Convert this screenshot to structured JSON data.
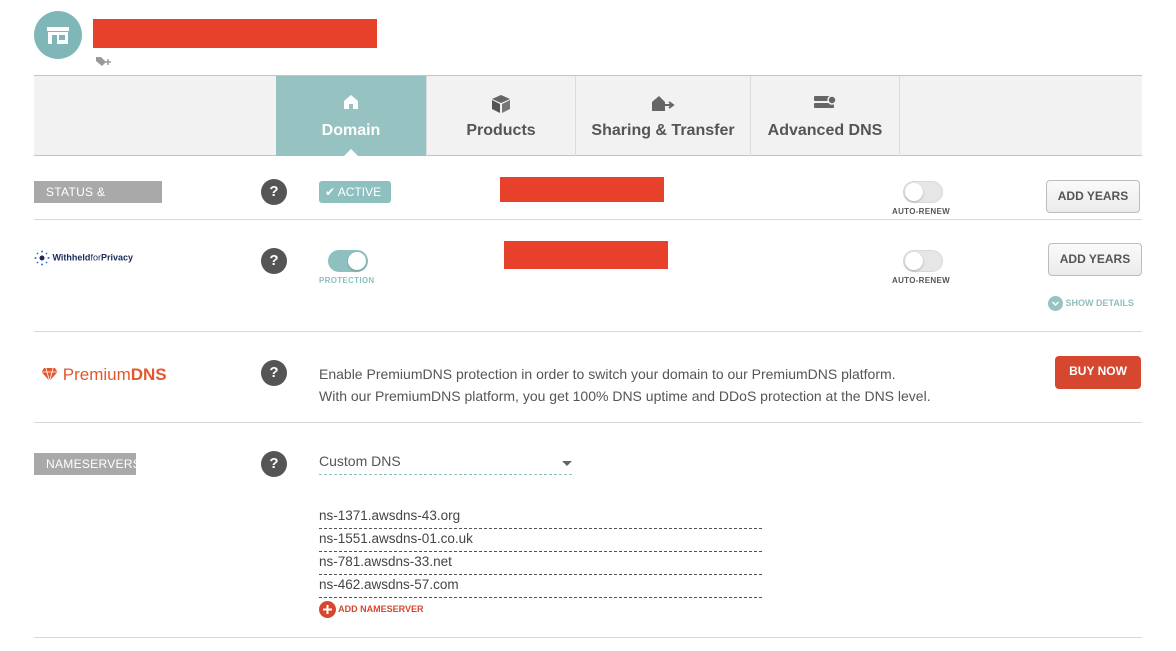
{
  "tabs": [
    {
      "label": "Domain",
      "icon": "home-icon",
      "active": true
    },
    {
      "label": "Products",
      "icon": "box-icon",
      "active": false
    },
    {
      "label": "Sharing & Transfer",
      "icon": "transfer-icon",
      "active": false
    },
    {
      "label": "Advanced DNS",
      "icon": "server-icon",
      "active": false
    }
  ],
  "status": {
    "label": "STATUS & VALIDITY",
    "badge": "ACTIVE",
    "autorenew_label": "AUTO-RENEW",
    "autorenew_on": false,
    "add_years": "ADD YEARS"
  },
  "privacy": {
    "logo_text_bold": "Withheld",
    "logo_text_thin": "for",
    "logo_text_end": "Privacy",
    "protection_label": "PROTECTION",
    "protection_on": true,
    "autorenew_label": "AUTO-RENEW",
    "autorenew_on": false,
    "add_years": "ADD YEARS",
    "show_details": "SHOW DETAILS"
  },
  "premium": {
    "logo_a": "Premium",
    "logo_b": "DNS",
    "line1": "Enable PremiumDNS protection in order to switch your domain to our PremiumDNS platform.",
    "line2": "With our PremiumDNS platform, you get 100% DNS uptime and DDoS protection at the DNS level.",
    "buy": "BUY NOW"
  },
  "nameservers": {
    "label": "NAMESERVERS",
    "selected": "Custom DNS",
    "entries": [
      "ns-1371.awsdns-43.org",
      "ns-1551.awsdns-01.co.uk",
      "ns-781.awsdns-33.net",
      "ns-462.awsdns-57.com"
    ],
    "add_label": "ADD NAMESERVER"
  },
  "help": "?",
  "colors": {
    "teal": "#96c2c2",
    "red": "#d5482f",
    "redaction": "#e8412b",
    "premium": "#e4572e"
  }
}
